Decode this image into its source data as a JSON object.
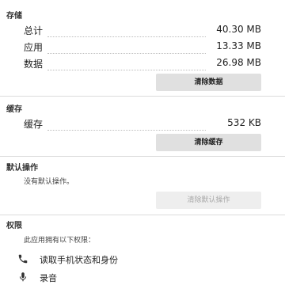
{
  "storage": {
    "header": "存储",
    "rows": [
      {
        "label": "总计",
        "value": "40.30 MB"
      },
      {
        "label": "应用",
        "value": "13.33 MB"
      },
      {
        "label": "数据",
        "value": "26.98 MB"
      }
    ],
    "clear_data_button": "清除数据"
  },
  "cache": {
    "header": "缓存",
    "rows": [
      {
        "label": "缓存",
        "value": "532 KB"
      }
    ],
    "clear_cache_button": "清除缓存"
  },
  "defaults": {
    "header": "默认操作",
    "description": "没有默认操作。",
    "clear_defaults_button": "清除默认操作"
  },
  "permissions": {
    "header": "权限",
    "intro": "此应用拥有以下权限：",
    "items": [
      {
        "icon": "phone-icon",
        "label": "读取手机状态和身份"
      },
      {
        "icon": "microphone-icon",
        "label": "录音"
      }
    ]
  }
}
